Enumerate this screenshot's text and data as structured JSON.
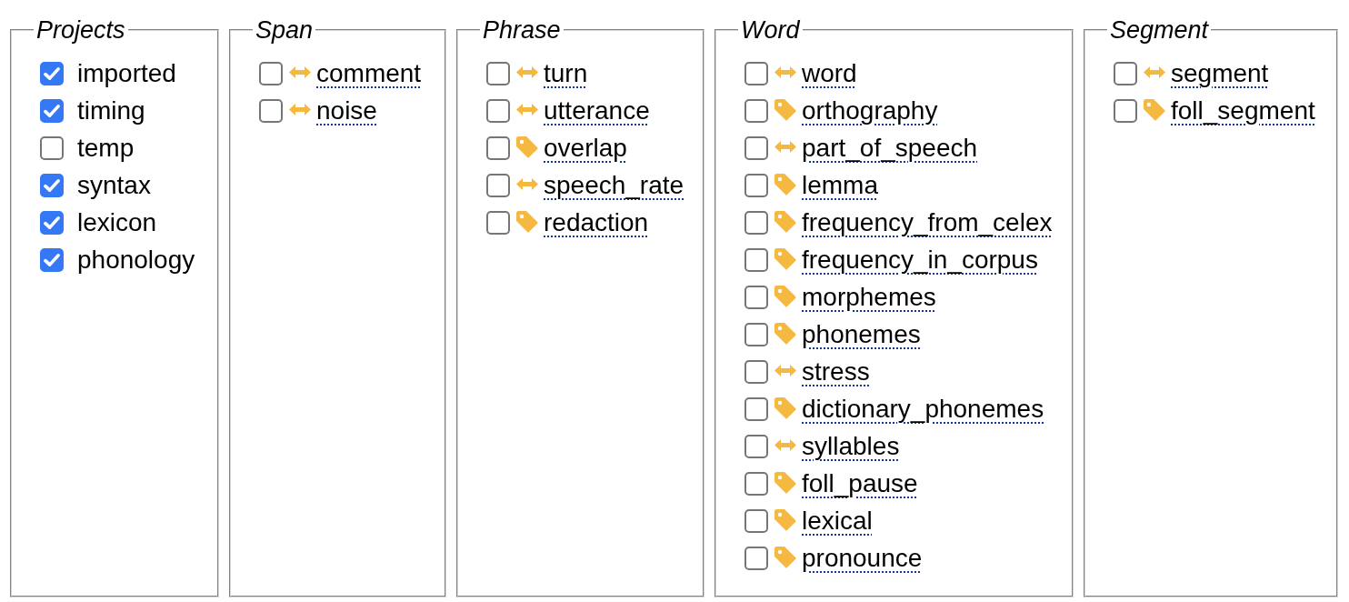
{
  "panels": [
    {
      "legend": "Projects",
      "items": [
        {
          "kind": "project",
          "label": "imported",
          "checked": true
        },
        {
          "kind": "project",
          "label": "timing",
          "checked": true
        },
        {
          "kind": "project",
          "label": "temp",
          "checked": false
        },
        {
          "kind": "project",
          "label": "syntax",
          "checked": true
        },
        {
          "kind": "project",
          "label": "lexicon",
          "checked": true
        },
        {
          "kind": "project",
          "label": "phonology",
          "checked": true
        }
      ]
    },
    {
      "legend": "Span",
      "items": [
        {
          "kind": "interval",
          "label": "comment",
          "checked": false
        },
        {
          "kind": "interval",
          "label": "noise",
          "checked": false
        }
      ]
    },
    {
      "legend": "Phrase",
      "items": [
        {
          "kind": "interval",
          "label": "turn",
          "checked": false
        },
        {
          "kind": "interval",
          "label": "utterance",
          "checked": false
        },
        {
          "kind": "tag",
          "label": "overlap",
          "checked": false
        },
        {
          "kind": "interval",
          "label": "speech_rate",
          "checked": false
        },
        {
          "kind": "tag",
          "label": "redaction",
          "checked": false
        }
      ]
    },
    {
      "legend": "Word",
      "items": [
        {
          "kind": "interval",
          "label": "word",
          "checked": false
        },
        {
          "kind": "tag",
          "label": "orthography",
          "checked": false
        },
        {
          "kind": "interval",
          "label": "part_of_speech",
          "checked": false
        },
        {
          "kind": "tag",
          "label": "lemma",
          "checked": false
        },
        {
          "kind": "tag",
          "label": "frequency_from_celex",
          "checked": false
        },
        {
          "kind": "tag",
          "label": "frequency_in_corpus",
          "checked": false
        },
        {
          "kind": "tag",
          "label": "morphemes",
          "checked": false
        },
        {
          "kind": "tag",
          "label": "phonemes",
          "checked": false
        },
        {
          "kind": "interval",
          "label": "stress",
          "checked": false
        },
        {
          "kind": "tag",
          "label": "dictionary_phonemes",
          "checked": false
        },
        {
          "kind": "interval",
          "label": "syllables",
          "checked": false
        },
        {
          "kind": "tag",
          "label": "foll_pause",
          "checked": false
        },
        {
          "kind": "tag",
          "label": "lexical",
          "checked": false
        },
        {
          "kind": "tag",
          "label": "pronounce",
          "checked": false
        }
      ]
    },
    {
      "legend": "Segment",
      "items": [
        {
          "kind": "interval",
          "label": "segment",
          "checked": false
        },
        {
          "kind": "tag",
          "label": "foll_segment",
          "checked": false
        }
      ]
    }
  ]
}
